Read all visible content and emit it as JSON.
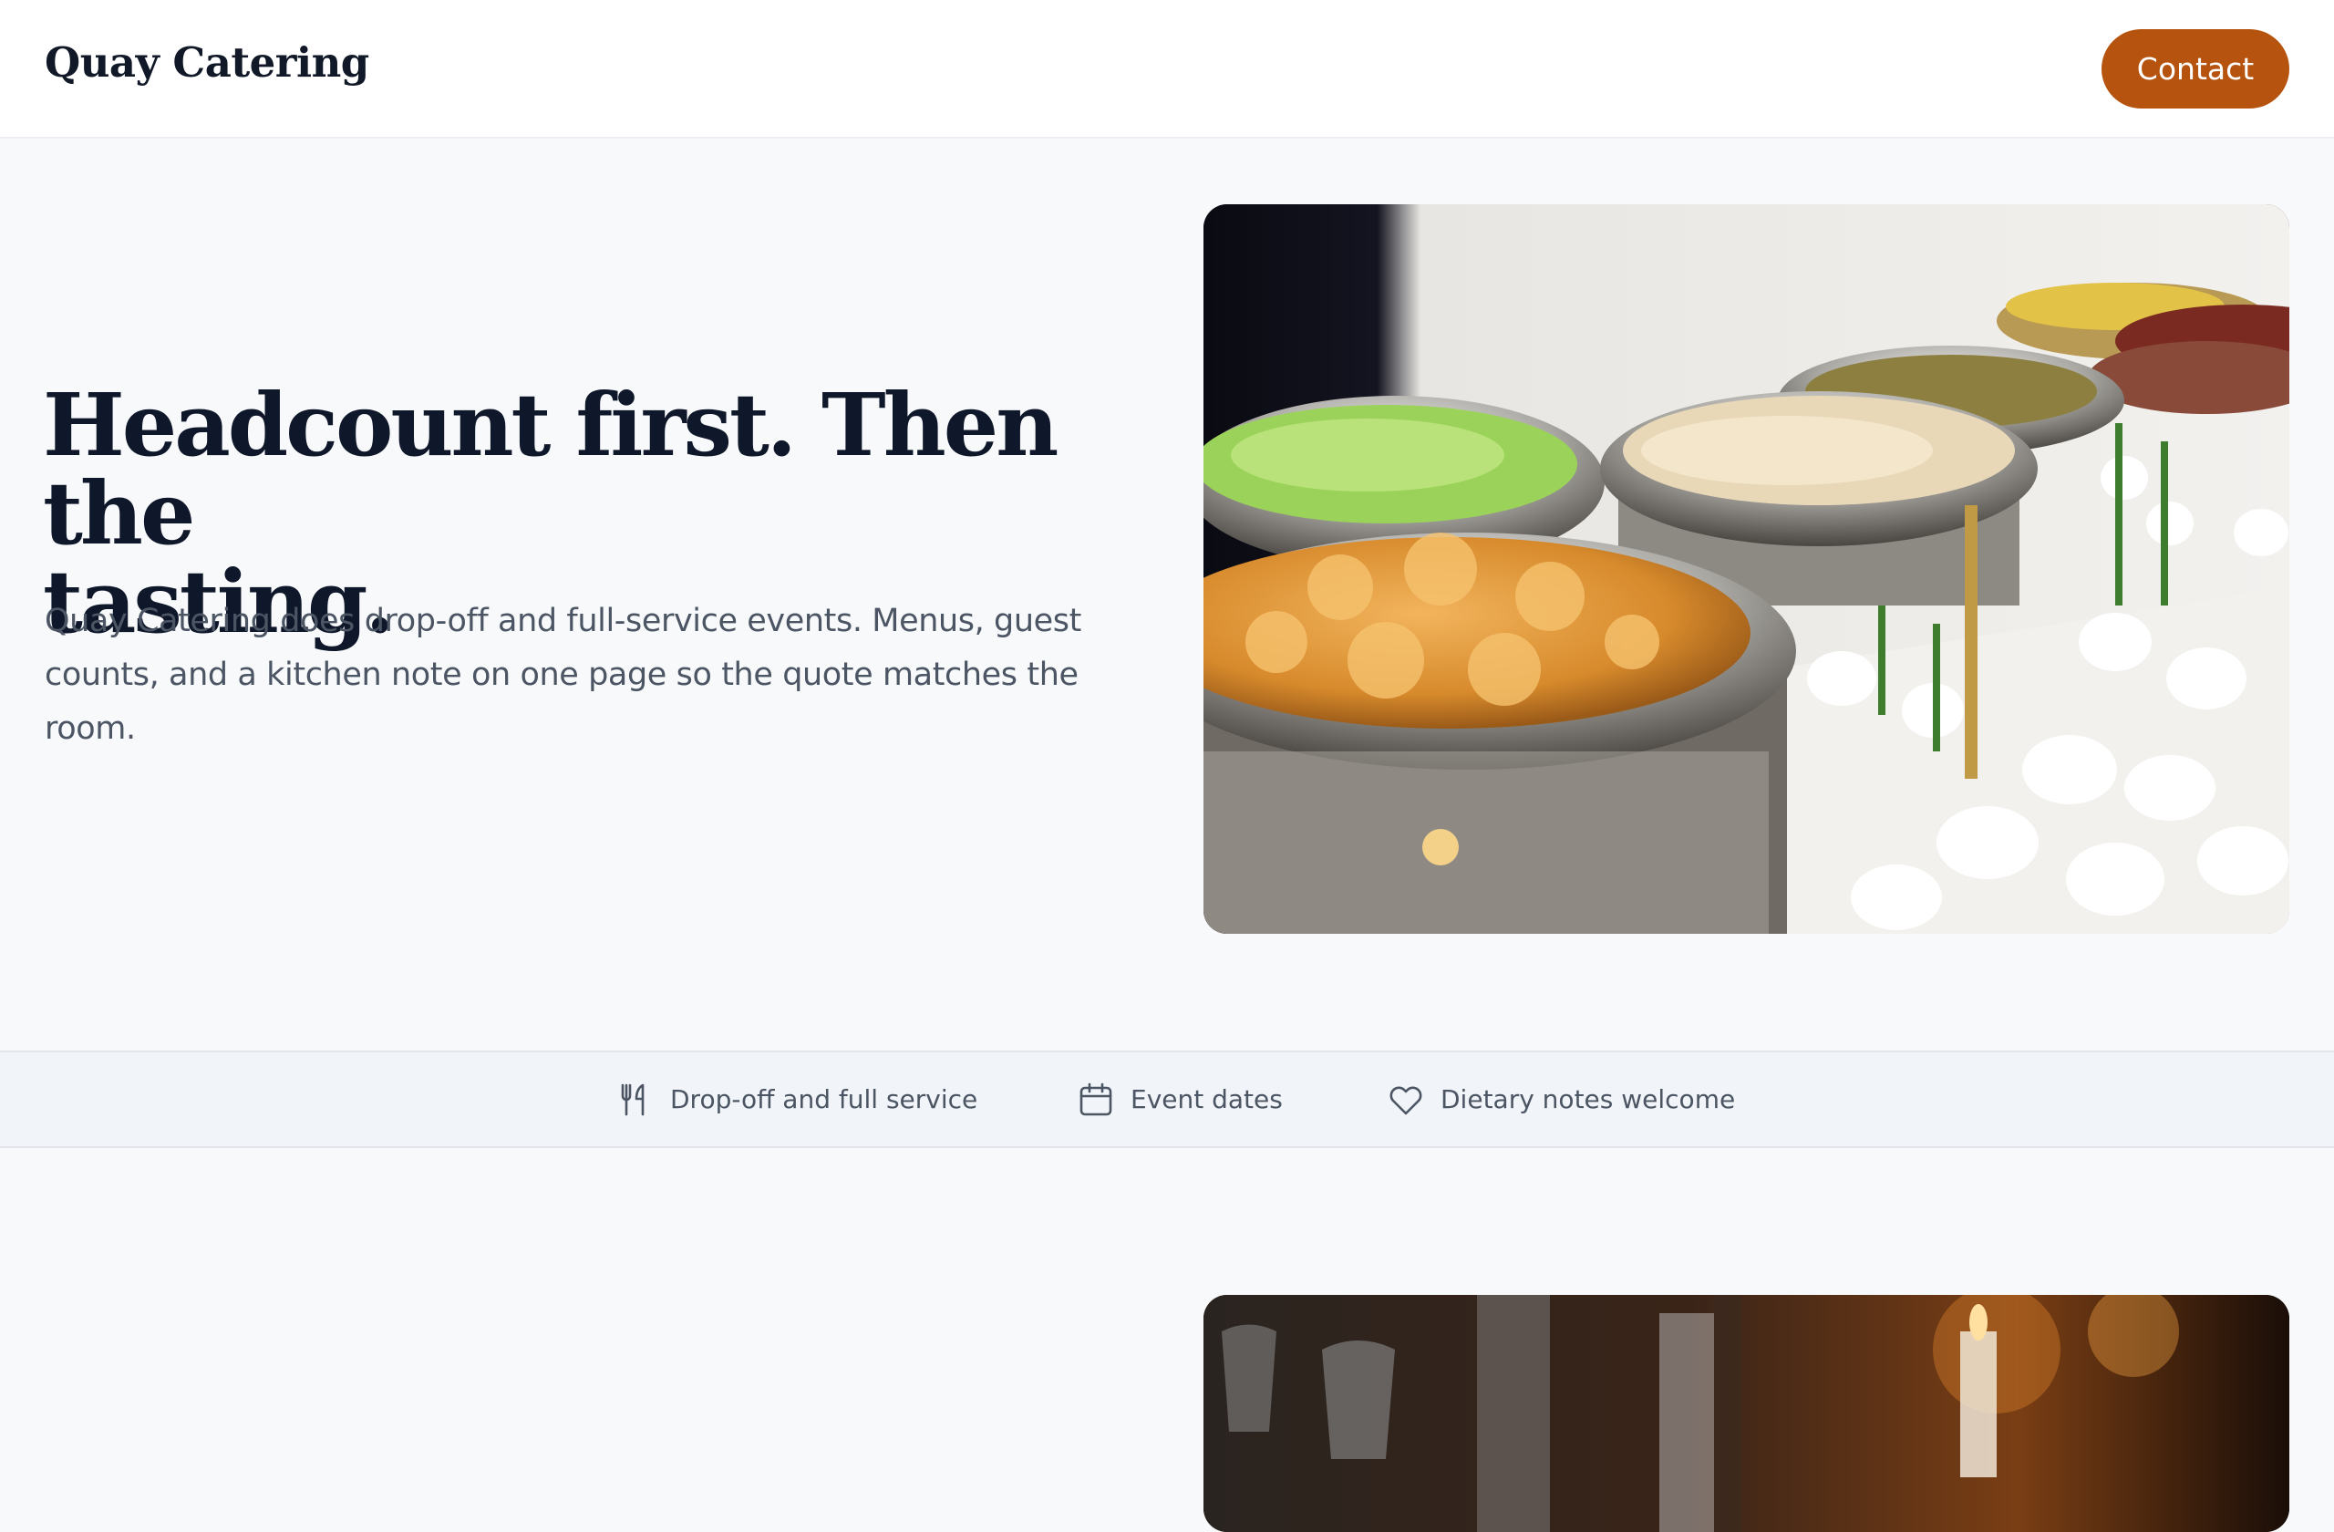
{
  "header": {
    "brand": "Quay Catering",
    "contact_label": "Contact"
  },
  "hero": {
    "title_line1": "Headcount first. Then the",
    "title_line2": "tasting.",
    "description": "Quay Catering does drop-off and full-service events. Menus, guest counts, and a kitchen note on one page so the quote matches the room.",
    "image_icon": "buffet-photo"
  },
  "features": [
    {
      "icon": "utensils-icon",
      "label": "Drop-off and full service"
    },
    {
      "icon": "calendar-icon",
      "label": "Event dates"
    },
    {
      "icon": "heart-icon",
      "label": "Dietary notes welcome"
    }
  ],
  "section2": {
    "image_icon": "table-setting-photo"
  },
  "colors": {
    "accent": "#b5530f",
    "heading": "#0f172a",
    "body_text": "#4b5563",
    "page_bg": "#f8f9fb"
  }
}
